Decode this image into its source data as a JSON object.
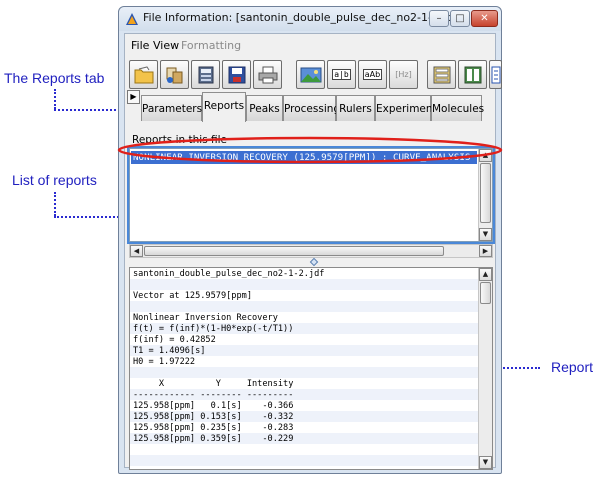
{
  "annotations": {
    "reports_tab": "The Reports tab",
    "list_of_reports": "List of reports",
    "report": "Report"
  },
  "window": {
    "title": "File Information: [santonin_double_pulse_dec_no2-1-2.jdf]",
    "minimize": "–",
    "maximize": "□",
    "close": "✕"
  },
  "menu": [
    "File",
    "View",
    "Formatting"
  ],
  "toolbar": {
    "text_button": "a|b",
    "text_button_2": "aAb",
    "hz_button": "[Hz]"
  },
  "tabs": {
    "scroll_left": "▶",
    "items": [
      "Parameters",
      "Reports",
      "Peaks",
      "Processing",
      "Rulers",
      "Experiment",
      "Molecules"
    ],
    "active": "Reports"
  },
  "reports_panel": {
    "label": "Reports in this file",
    "selected_item": "NONLINEAR INVERSION RECOVERY (125.9579[PPM]) : CURVE_ANALYSIS  (13-JAN-2"
  },
  "scroll": {
    "up": "▲",
    "down": "▼",
    "left": "◀",
    "right": "▶"
  },
  "report_text": [
    "santonin_double_pulse_dec_no2-1-2.jdf",
    "",
    "Vector at 125.9579[ppm]",
    "",
    "Nonlinear Inversion Recovery",
    "f(t) = f(inf)*(1-H0*exp(-t/T1))",
    "f(inf) = 0.42852",
    "T1 = 1.4096[s]",
    "H0 = 1.97222",
    "",
    "     X          Y     Intensity",
    "------------ -------- ---------",
    "125.958[ppm]   0.1[s]    -0.366",
    "125.958[ppm] 0.153[s]    -0.332",
    "125.958[ppm] 0.235[s]    -0.283",
    "125.958[ppm] 0.359[s]    -0.229"
  ],
  "colors": {
    "callout": "#1f1fbf",
    "selection": "#3c6fd1",
    "highlight_ellipse": "#e0201a",
    "focus_border": "#4a88d8"
  }
}
